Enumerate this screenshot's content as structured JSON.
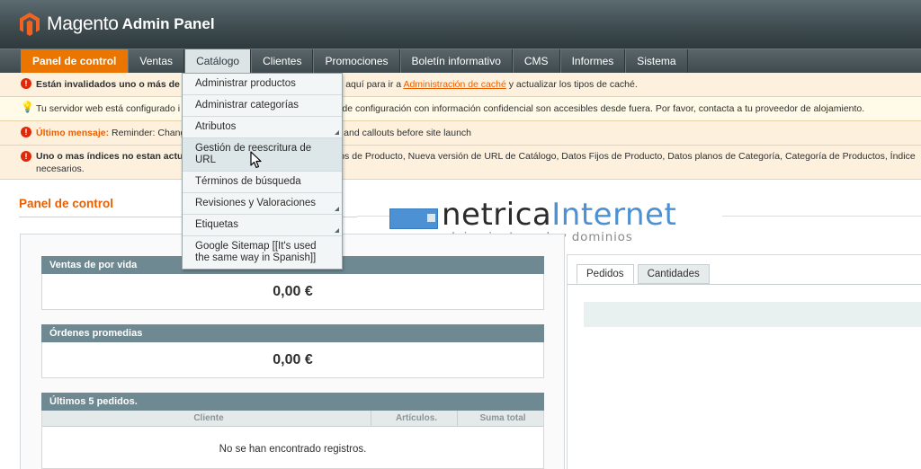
{
  "header": {
    "brand": "Magento",
    "product": "Admin Panel"
  },
  "nav": [
    {
      "label": "Panel de control",
      "active": true
    },
    {
      "label": "Ventas"
    },
    {
      "label": "Catálogo",
      "hover": true
    },
    {
      "label": "Clientes"
    },
    {
      "label": "Promociones"
    },
    {
      "label": "Boletín informativo"
    },
    {
      "label": "CMS"
    },
    {
      "label": "Informes"
    },
    {
      "label": "Sistema"
    }
  ],
  "messages": {
    "m1": {
      "bold": "Están invalidados uno o más de",
      "text": "ic aquí para ir a",
      "link": "Administración de caché",
      "tail": "y actualizar los tipos de caché."
    },
    "m2": {
      "text": "Tu servidor web está configurado i",
      "tail": "cheros de configuración con información confidencial son accesibles desde fuera. Por favor, contacta a tu proveedor de alojamiento."
    },
    "m3": {
      "label": "Último mensaje:",
      "text": "Reminder: Chang",
      "tail": "and callouts before site launch"
    },
    "m4": {
      "bold": "Uno o mas índices no estan actu",
      "tail": "os de Producto, Nueva versión de URL de Catálogo, Datos Fijos de Producto, Datos planos de Categoría, Categoría de Productos, Índice",
      "line2": "necesarios."
    }
  },
  "catalog_menu": [
    {
      "label": "Administrar productos",
      "has_sub": false
    },
    {
      "label": "Administrar categorías",
      "has_sub": false
    },
    {
      "label": "Atributos",
      "has_sub": true
    },
    {
      "label": "Gestión de reescritura de URL",
      "has_sub": false,
      "hover": true
    },
    {
      "label": "Términos de búsqueda",
      "has_sub": false
    },
    {
      "label": "Revisiones y Valoraciones",
      "has_sub": true
    },
    {
      "label": "Etiquetas",
      "has_sub": true
    },
    {
      "label": "Google Sitemap [[It's used the same way in Spanish]]",
      "has_sub": false
    }
  ],
  "page": {
    "title": "Panel de control"
  },
  "lifetime_sales": {
    "title": "Ventas de por vida",
    "value": "0,00 €"
  },
  "average_orders": {
    "title": "Órdenes promedias",
    "value": "0,00 €"
  },
  "last_orders": {
    "title": "Últimos 5 pedidos.",
    "columns": [
      "Cliente",
      "Artículos.",
      "Suma total"
    ],
    "empty": "No se han encontrado registros."
  },
  "tabs": [
    {
      "label": "Pedidos",
      "active": true
    },
    {
      "label": "Cantidades"
    }
  ],
  "watermark": {
    "word1": "netrica",
    "word2": "Internet",
    "tagline": "alojamiento web y dominios"
  },
  "colors": {
    "accent": "#eb5e00",
    "box_header": "#6f8992",
    "nav_active": "#ea7601"
  }
}
